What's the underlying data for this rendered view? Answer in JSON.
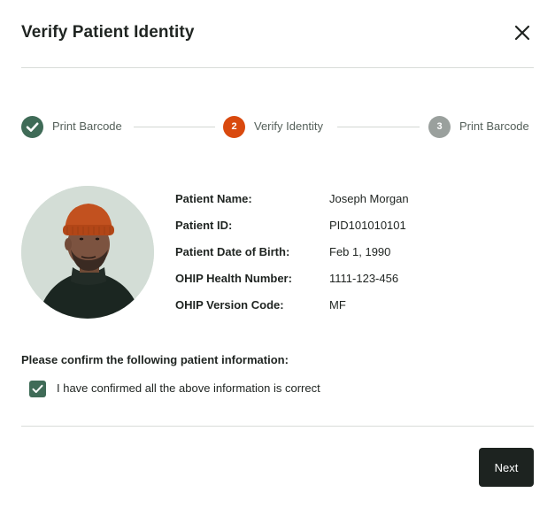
{
  "dialog": {
    "title": "Verify Patient Identity",
    "close_icon": "close-icon"
  },
  "stepper": {
    "steps": [
      {
        "label": "Print Barcode",
        "state": "complete",
        "marker_icon": "check-circle-icon"
      },
      {
        "label": "Verify Identity",
        "state": "active",
        "number": "2"
      },
      {
        "label": "Print Barcode",
        "state": "upcoming",
        "number": "3"
      }
    ],
    "colors": {
      "complete": "#3f6b57",
      "active": "#d9490e",
      "upcoming": "#9aa09d"
    }
  },
  "patient": {
    "photo_icon": "patient-photo",
    "fields": [
      {
        "label": "Patient Name:",
        "value": "Joseph Morgan"
      },
      {
        "label": "Patient ID:",
        "value": "PID101010101"
      },
      {
        "label": "Patient Date of Birth:",
        "value": "Feb 1, 1990"
      },
      {
        "label": "OHIP Health Number:",
        "value": "1111-123-456"
      },
      {
        "label": "OHIP Version Code:",
        "value": "MF"
      }
    ]
  },
  "confirmation": {
    "prompt": "Please confirm the following patient information:",
    "checkbox_label": "I have confirmed all the above information is correct",
    "checked": true
  },
  "footer": {
    "next_label": "Next"
  },
  "colors": {
    "accent": "#3f6b57",
    "primary_button": "#1d2320"
  }
}
